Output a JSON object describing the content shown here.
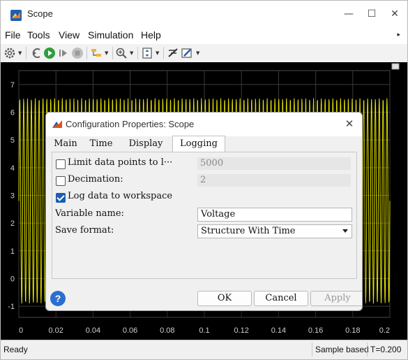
{
  "window": {
    "title": "Scope",
    "minimize": "—",
    "maximize": "☐",
    "close": "✕"
  },
  "menu": {
    "items": [
      "File",
      "Tools",
      "View",
      "Simulation",
      "Help"
    ],
    "overflow": "▸"
  },
  "toolbar": {
    "icons": [
      "gear-icon",
      "stop-back-icon",
      "run-icon",
      "step-forward-icon",
      "stop-icon",
      "highlight-icon",
      "zoom-icon",
      "scale-axes-icon",
      "cursor-measure-icon",
      "style-icon"
    ]
  },
  "plot": {
    "y_ticks": [
      "7",
      "6",
      "5",
      "4",
      "3",
      "2",
      "1",
      "0",
      "-1"
    ],
    "x_ticks": [
      "0",
      "0.02",
      "0.04",
      "0.06",
      "0.08",
      "0.1",
      "0.12",
      "0.14",
      "0.16",
      "0.18",
      "0.2"
    ],
    "signal_color": "#e6e600",
    "background": "#000000",
    "grid_color": "#3a3a3a"
  },
  "dialog": {
    "title": "Configuration Properties: Scope",
    "close": "✕",
    "tabs": [
      "Main",
      "Time",
      "Display",
      "Logging"
    ],
    "active_tab": "Logging",
    "limit_label": "Limit data points to l···",
    "limit_value": "5000",
    "decimation_label": "Decimation:",
    "decimation_value": "2",
    "log_label": "Log data to workspace",
    "log_checked": true,
    "variable_label": "Variable name:",
    "variable_value": "Voltage",
    "format_label": "Save format:",
    "format_value": "Structure With Time",
    "help": "?",
    "ok": "OK",
    "cancel": "Cancel",
    "apply": "Apply"
  },
  "status": {
    "left": "Ready",
    "mode": "Sample based",
    "time": "T=0.200"
  },
  "colors": {
    "accent": "#1a5fb4",
    "matlab_orange": "#d9531e"
  }
}
